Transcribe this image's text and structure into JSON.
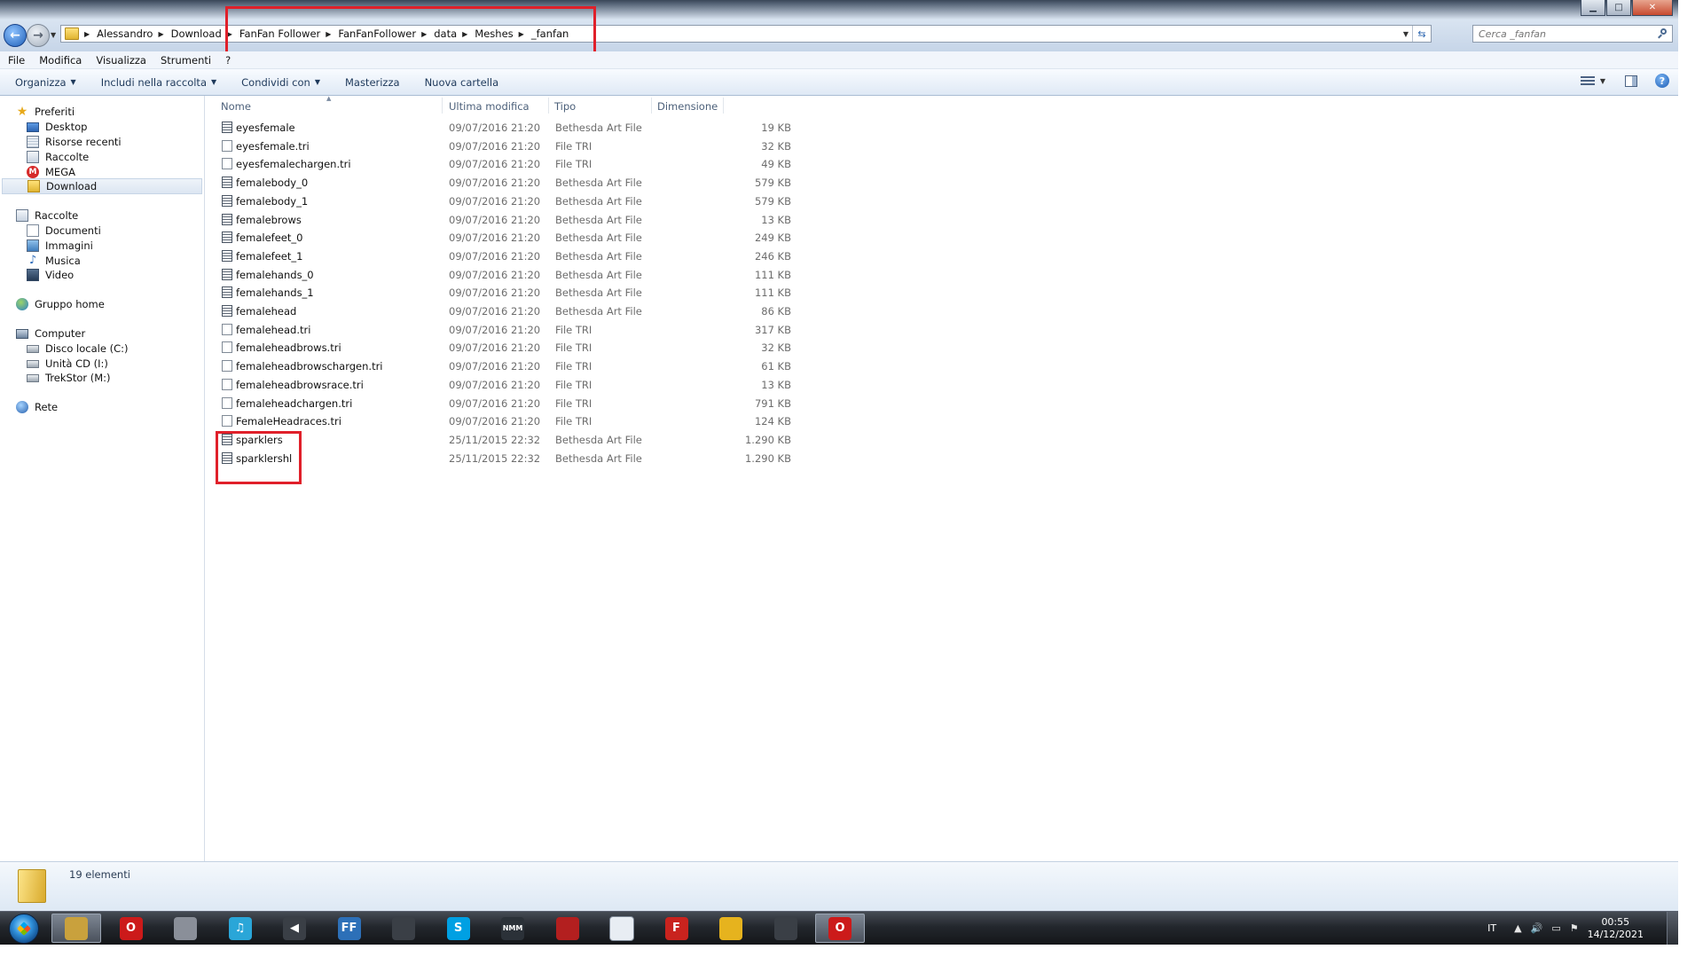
{
  "window": {
    "window_controls": {
      "minimize": "▁",
      "maximize": "□",
      "close": "✕"
    }
  },
  "navigation": {
    "back": "←",
    "forward": "→"
  },
  "address_bar": {
    "crumbs": [
      "Alessandro",
      "Download",
      "FanFan Follower",
      "FanFanFollower",
      "data",
      "Meshes",
      "_fanfan"
    ]
  },
  "search": {
    "placeholder": "Cerca _fanfan"
  },
  "menubar": [
    "File",
    "Modifica",
    "Visualizza",
    "Strumenti",
    "?"
  ],
  "toolbar": {
    "organizza": "Organizza",
    "includi": "Includi nella raccolta",
    "condividi": "Condividi con",
    "masterizza": "Masterizza",
    "nuova_cartella": "Nuova cartella",
    "help": "?"
  },
  "sidebar": {
    "favorites": {
      "header": "Preferiti",
      "items": [
        "Desktop",
        "Risorse recenti",
        "Raccolte",
        "MEGA",
        "Download"
      ]
    },
    "libraries": {
      "header": "Raccolte",
      "items": [
        "Documenti",
        "Immagini",
        "Musica",
        "Video"
      ]
    },
    "homegroup": {
      "header": "Gruppo home"
    },
    "computer": {
      "header": "Computer",
      "items": [
        "Disco locale (C:)",
        "Unità CD (I:)",
        "TrekStor (M:)"
      ]
    },
    "network": {
      "header": "Rete"
    },
    "selected": "Download",
    "icon_labels": {
      "mega": "M"
    }
  },
  "columns": {
    "name": "Nome",
    "modified": "Ultima modifica",
    "type": "Tipo",
    "size": "Dimensione"
  },
  "files": [
    {
      "name": "eyesfemale",
      "date": "09/07/2016 21:20",
      "type": "Bethesda Art File",
      "size": "19 KB",
      "icon": "nif-file-icon"
    },
    {
      "name": "eyesfemale.tri",
      "date": "09/07/2016 21:20",
      "type": "File TRI",
      "size": "32 KB",
      "icon": "blank-file-icon"
    },
    {
      "name": "eyesfemalechargen.tri",
      "date": "09/07/2016 21:20",
      "type": "File TRI",
      "size": "49 KB",
      "icon": "blank-file-icon"
    },
    {
      "name": "femalebody_0",
      "date": "09/07/2016 21:20",
      "type": "Bethesda Art File",
      "size": "579 KB",
      "icon": "nif-file-icon"
    },
    {
      "name": "femalebody_1",
      "date": "09/07/2016 21:20",
      "type": "Bethesda Art File",
      "size": "579 KB",
      "icon": "nif-file-icon"
    },
    {
      "name": "femalebrows",
      "date": "09/07/2016 21:20",
      "type": "Bethesda Art File",
      "size": "13 KB",
      "icon": "nif-file-icon"
    },
    {
      "name": "femalefeet_0",
      "date": "09/07/2016 21:20",
      "type": "Bethesda Art File",
      "size": "249 KB",
      "icon": "nif-file-icon"
    },
    {
      "name": "femalefeet_1",
      "date": "09/07/2016 21:20",
      "type": "Bethesda Art File",
      "size": "246 KB",
      "icon": "nif-file-icon"
    },
    {
      "name": "femalehands_0",
      "date": "09/07/2016 21:20",
      "type": "Bethesda Art File",
      "size": "111 KB",
      "icon": "nif-file-icon"
    },
    {
      "name": "femalehands_1",
      "date": "09/07/2016 21:20",
      "type": "Bethesda Art File",
      "size": "111 KB",
      "icon": "nif-file-icon"
    },
    {
      "name": "femalehead",
      "date": "09/07/2016 21:20",
      "type": "Bethesda Art File",
      "size": "86 KB",
      "icon": "nif-file-icon"
    },
    {
      "name": "femalehead.tri",
      "date": "09/07/2016 21:20",
      "type": "File TRI",
      "size": "317 KB",
      "icon": "blank-file-icon"
    },
    {
      "name": "femaleheadbrows.tri",
      "date": "09/07/2016 21:20",
      "type": "File TRI",
      "size": "32 KB",
      "icon": "blank-file-icon"
    },
    {
      "name": "femaleheadbrowschargen.tri",
      "date": "09/07/2016 21:20",
      "type": "File TRI",
      "size": "61 KB",
      "icon": "blank-file-icon"
    },
    {
      "name": "femaleheadbrowsrace.tri",
      "date": "09/07/2016 21:20",
      "type": "File TRI",
      "size": "13 KB",
      "icon": "blank-file-icon"
    },
    {
      "name": "femaleheadchargen.tri",
      "date": "09/07/2016 21:20",
      "type": "File TRI",
      "size": "791 KB",
      "icon": "blank-file-icon"
    },
    {
      "name": "FemaleHeadraces.tri",
      "date": "09/07/2016 21:20",
      "type": "File TRI",
      "size": "124 KB",
      "icon": "blank-file-icon"
    },
    {
      "name": "sparklers",
      "date": "25/11/2015 22:32",
      "type": "Bethesda Art File",
      "size": "1.290 KB",
      "icon": "nif-file-icon"
    },
    {
      "name": "sparklershl",
      "date": "25/11/2015 22:32",
      "type": "Bethesda Art File",
      "size": "1.290 KB",
      "icon": "nif-file-icon"
    }
  ],
  "status": {
    "count": "19 elementi"
  },
  "taskbar": {
    "apps": [
      {
        "name": "explorer",
        "label": "",
        "color": "#c9a13d",
        "active": true
      },
      {
        "name": "opera",
        "label": "O",
        "color": "#cc1a1a"
      },
      {
        "name": "app-grid",
        "label": "",
        "color": "#8a8f99"
      },
      {
        "name": "itunes",
        "label": "♫",
        "color": "#2aa6d8"
      },
      {
        "name": "speaker-app",
        "label": "◀",
        "color": "#3a3f46"
      },
      {
        "name": "ffdec",
        "label": "FF",
        "color": "#2d70b8"
      },
      {
        "name": "people-app",
        "label": "",
        "color": "#3a3f46"
      },
      {
        "name": "skype",
        "label": "S",
        "color": "#00a0e3"
      },
      {
        "name": "nmm",
        "label": "NMM",
        "color": "#2b3138"
      },
      {
        "name": "red-gear-app",
        "label": "",
        "color": "#b31f1f"
      },
      {
        "name": "window-app",
        "label": "",
        "color": "#e8edf3"
      },
      {
        "name": "filezilla",
        "label": "F",
        "color": "#c9231e"
      },
      {
        "name": "yellow-app",
        "label": "",
        "color": "#e6b31e"
      },
      {
        "name": "skyrim",
        "label": "",
        "color": "#3a3f46"
      },
      {
        "name": "opera-2",
        "label": "O",
        "color": "#cc1a1a",
        "active": true
      }
    ]
  },
  "tray": {
    "language": "IT",
    "time": "00:55",
    "date": "14/12/2021",
    "up_arrow": "▲",
    "volume": "🔊",
    "network": "▭",
    "flag": "⚑"
  }
}
